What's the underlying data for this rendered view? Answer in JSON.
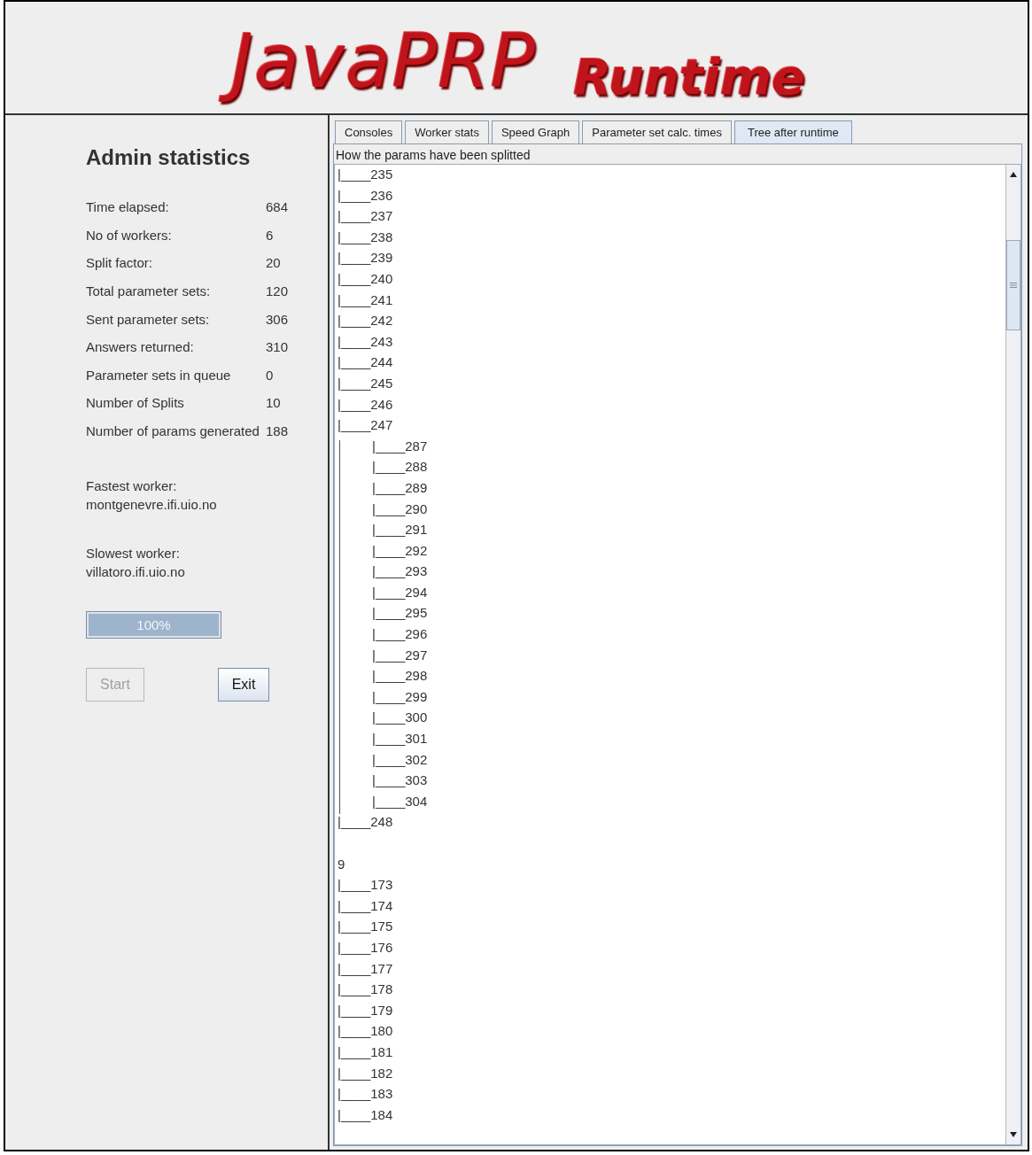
{
  "header": {
    "logo_main": "JavaPRP",
    "logo_sub": "Runtime"
  },
  "admin": {
    "title": "Admin statistics",
    "stats": [
      {
        "label": "Time elapsed:",
        "value": "684"
      },
      {
        "label": "No of workers:",
        "value": "6"
      },
      {
        "label": "Split factor:",
        "value": "20"
      },
      {
        "label": "Total parameter sets:",
        "value": "120"
      },
      {
        "label": "Sent parameter sets:",
        "value": "306"
      },
      {
        "label": "Answers returned:",
        "value": "310"
      },
      {
        "label": "Parameter sets in queue",
        "value": "0"
      },
      {
        "label": "Number of Splits",
        "value": "10"
      },
      {
        "label": "Number of params generated",
        "value": "188"
      }
    ],
    "workers": [
      {
        "label": "Fastest worker:",
        "host": "montgenevre.ifi.uio.no"
      },
      {
        "label": "Slowest worker:",
        "host": "villatoro.ifi.uio.no"
      }
    ],
    "progress": {
      "level": 1,
      "text": "100%"
    },
    "buttons": [
      {
        "label": "Start",
        "disabled": true
      },
      {
        "label": "Exit",
        "disabled": false
      }
    ]
  },
  "tabs": [
    {
      "label": "Consoles",
      "selected": false
    },
    {
      "label": "Worker stats",
      "selected": false
    },
    {
      "label": "Speed Graph",
      "selected": false
    },
    {
      "label": "Parameter set calc. times",
      "selected": false
    },
    {
      "label": "Tree after runtime",
      "selected": true
    }
  ],
  "tree_title": "How the params have been splitted",
  "tree": [
    {
      "kind": "entry",
      "label": "|____235"
    },
    {
      "kind": "entry",
      "label": "|____236"
    },
    {
      "kind": "entry",
      "label": "|____237"
    },
    {
      "kind": "entry",
      "label": "|____238"
    },
    {
      "kind": "entry",
      "label": "|____239"
    },
    {
      "kind": "entry",
      "label": "|____240"
    },
    {
      "kind": "entry",
      "label": "|____241"
    },
    {
      "kind": "entry",
      "label": "|____242"
    },
    {
      "kind": "entry",
      "label": "|____243"
    },
    {
      "kind": "entry",
      "label": "|____244"
    },
    {
      "kind": "entry",
      "label": "|____245"
    },
    {
      "kind": "entry",
      "label": "|____246"
    },
    {
      "kind": "entry",
      "label": "|____247",
      "children": [
        {
          "kind": "entry",
          "label": "|____287"
        },
        {
          "kind": "entry",
          "label": "|____288"
        },
        {
          "kind": "entry",
          "label": "|____289"
        },
        {
          "kind": "entry",
          "label": "|____290"
        },
        {
          "kind": "entry",
          "label": "|____291"
        },
        {
          "kind": "entry",
          "label": "|____292"
        },
        {
          "kind": "entry",
          "label": "|____293"
        },
        {
          "kind": "entry",
          "label": "|____294"
        },
        {
          "kind": "entry",
          "label": "|____295"
        },
        {
          "kind": "entry",
          "label": "|____296"
        },
        {
          "kind": "entry",
          "label": "|____297"
        },
        {
          "kind": "entry",
          "label": "|____298"
        },
        {
          "kind": "entry",
          "label": "|____299"
        },
        {
          "kind": "entry",
          "label": "|____300"
        },
        {
          "kind": "entry",
          "label": "|____301"
        },
        {
          "kind": "entry",
          "label": "|____302"
        },
        {
          "kind": "entry",
          "label": "|____303"
        },
        {
          "kind": "entry",
          "label": "|____304"
        }
      ]
    },
    {
      "kind": "entry",
      "label": "|____248"
    },
    {
      "kind": "root",
      "label": "9",
      "children": [
        {
          "kind": "entry",
          "label": "|____173"
        },
        {
          "kind": "entry",
          "label": "|____174"
        },
        {
          "kind": "entry",
          "label": "|____175"
        },
        {
          "kind": "entry",
          "label": "|____176"
        },
        {
          "kind": "entry",
          "label": "|____177"
        },
        {
          "kind": "entry",
          "label": "|____178"
        },
        {
          "kind": "entry",
          "label": "|____179"
        },
        {
          "kind": "entry",
          "label": "|____180"
        },
        {
          "kind": "entry",
          "label": "|____181"
        },
        {
          "kind": "entry",
          "label": "|____182"
        },
        {
          "kind": "entry",
          "label": "|____183"
        },
        {
          "kind": "entry",
          "label": "|____184"
        }
      ]
    }
  ]
}
